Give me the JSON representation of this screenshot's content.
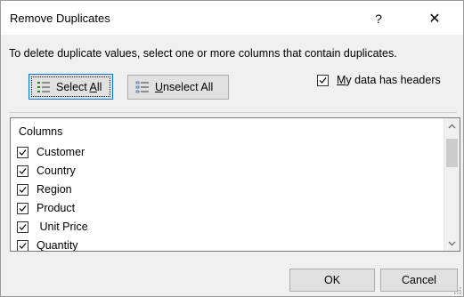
{
  "window": {
    "title": "Remove Duplicates",
    "help_label": "?",
    "close_label": "✕"
  },
  "instruction": "To delete duplicate values, select one or more columns that contain duplicates.",
  "buttons": {
    "select_all": {
      "pre": "Select ",
      "accel": "A",
      "post": "ll"
    },
    "unselect_all": {
      "pre": "",
      "accel": "U",
      "post": "nselect All"
    },
    "ok": "OK",
    "cancel": "Cancel"
  },
  "headers_checkbox": {
    "checked": true,
    "pre": "",
    "accel": "M",
    "post": "y data has headers"
  },
  "columns_list": {
    "header": "Columns",
    "items": [
      {
        "label": "Customer",
        "checked": true
      },
      {
        "label": "Country",
        "checked": true
      },
      {
        "label": "Region",
        "checked": true
      },
      {
        "label": "Product",
        "checked": true
      },
      {
        "label": " Unit Price",
        "checked": true
      },
      {
        "label": "Quantity",
        "checked": true
      }
    ]
  },
  "colors": {
    "focus_border": "#0078d7",
    "select_icon_green": "#2e7d32",
    "unselect_icon_blue": "#3b6cb0"
  },
  "icons": {
    "select_all": "select-all-list-icon",
    "unselect_all": "unselect-all-list-icon",
    "checkmark": "checkmark-icon",
    "scroll_up": "chevron-up-icon",
    "scroll_down": "chevron-down-icon"
  }
}
